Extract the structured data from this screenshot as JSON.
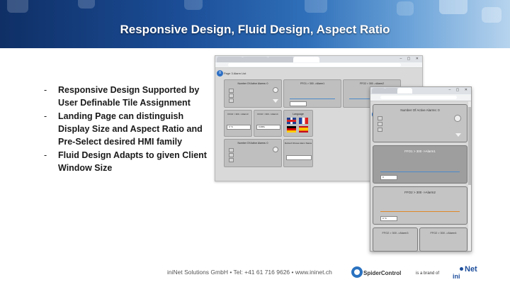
{
  "slide": {
    "title": "Responsive Design, Fluid Design, Aspect Ratio"
  },
  "bullets": [
    {
      "marker": "-",
      "text": "Responsive Design Supported by User Definable Tile Assignment"
    },
    {
      "marker": "-",
      "text": "Landing Page can distinguish Display Size and Aspect Ratio and Pre-Select desired HMI family"
    },
    {
      "marker": "-",
      "text": "Fluid Design Adapts to given Client Window Size"
    }
  ],
  "screenshot_desktop": {
    "page_label": "Page 3 Alarm List",
    "tiles": {
      "active_alarms": "Number Of Active Alarms:  0",
      "alarm1": "FFO1 > 300 ->Alarm1",
      "alarm2": "FFO2 > 300 ->Alarm2",
      "alarm3": "FFO2 > 300 ->Alarm3",
      "alarm4": "FFO2 > 300 ->Alarm4",
      "language": "Language",
      "active_alarms_2": "Number Of Active Alarms:  0",
      "refresh": "Refresh Shows Alarm Status",
      "field1": "0 °C",
      "field2": "0 MPA"
    }
  },
  "screenshot_mobile": {
    "tiles": {
      "active_alarms": "Number Of Active Alarms:  0",
      "alarm1": "FFO1 > 300 ->Alarm1",
      "alarm2": "FFO2 > 300 ->Alarm2",
      "alarm3": "FFO2 > 300 ->Alarm3",
      "alarm4": "FFO2 > 300 ->Alarm4",
      "value1": "0",
      "value2": "0 °C"
    }
  },
  "footer": {
    "company": "iniNet Solutions GmbH • Tel: +41 61 716 9626 • www.ininet.ch",
    "spider_brand": "SpiderControl",
    "brand_of": "is a brand of",
    "ininet_top": "Net",
    "ininet_bottom": "ini"
  },
  "colors": {
    "banner_dark": "#0f2f66",
    "banner_light": "#b7d4ee",
    "ininet_blue": "#1e4e9c",
    "spider_blue": "#2a72c0"
  }
}
